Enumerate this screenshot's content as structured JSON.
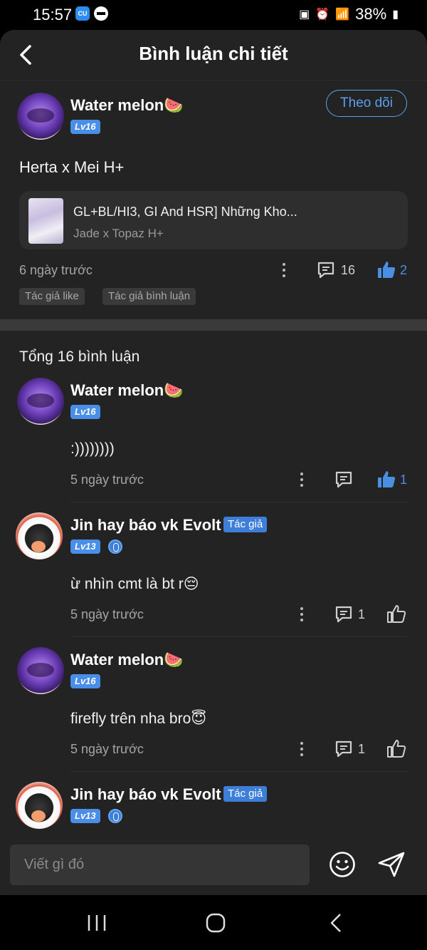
{
  "status_bar": {
    "time": "15:57",
    "app_icon_text": "CU",
    "battery": "38%"
  },
  "header": {
    "title": "Bình luận chi tiết",
    "back_icon": "back-arrow-icon"
  },
  "post": {
    "author": "Water melon🍉",
    "level": "Lv16",
    "follow_label": "Theo dõi",
    "text": "Herta x Mei H+",
    "reference": {
      "title": "GL+BL/HI3, GI And HSR] Những Kho...",
      "subtitle": "Jade x Topaz H+"
    },
    "time": "6 ngày trước",
    "comment_count": "16",
    "like_count": "2",
    "tags": [
      "Tác giả like",
      "Tác giả bình luận"
    ]
  },
  "comments_header": "Tổng 16 bình luận",
  "comments": [
    {
      "author": "Water melon🍉",
      "level": "Lv16",
      "author_tag": "",
      "text": ":))))))))",
      "time": "5 ngày trước",
      "reply_count": "",
      "like_count": "1",
      "liked": true
    },
    {
      "author": "Jin hay báo vk Evolt",
      "level": "Lv13",
      "author_tag": "Tác giả",
      "text": "ừ nhìn cmt là bt r😔",
      "time": "5 ngày trước",
      "reply_count": "1",
      "like_count": "",
      "liked": false
    },
    {
      "author": "Water melon🍉",
      "level": "Lv16",
      "author_tag": "",
      "text": "firefly trên nha bro😇",
      "time": "5 ngày trước",
      "reply_count": "1",
      "like_count": "",
      "liked": false
    },
    {
      "author": "Jin hay báo vk Evolt",
      "level": "Lv13",
      "author_tag": "Tác giả",
      "text": "",
      "time": "",
      "reply_count": "",
      "like_count": "",
      "liked": false
    }
  ],
  "input_bar": {
    "placeholder": "Viết gì đó"
  },
  "colors": {
    "accent": "#4a90e2",
    "background": "#232323",
    "card": "#2e2e2e"
  }
}
